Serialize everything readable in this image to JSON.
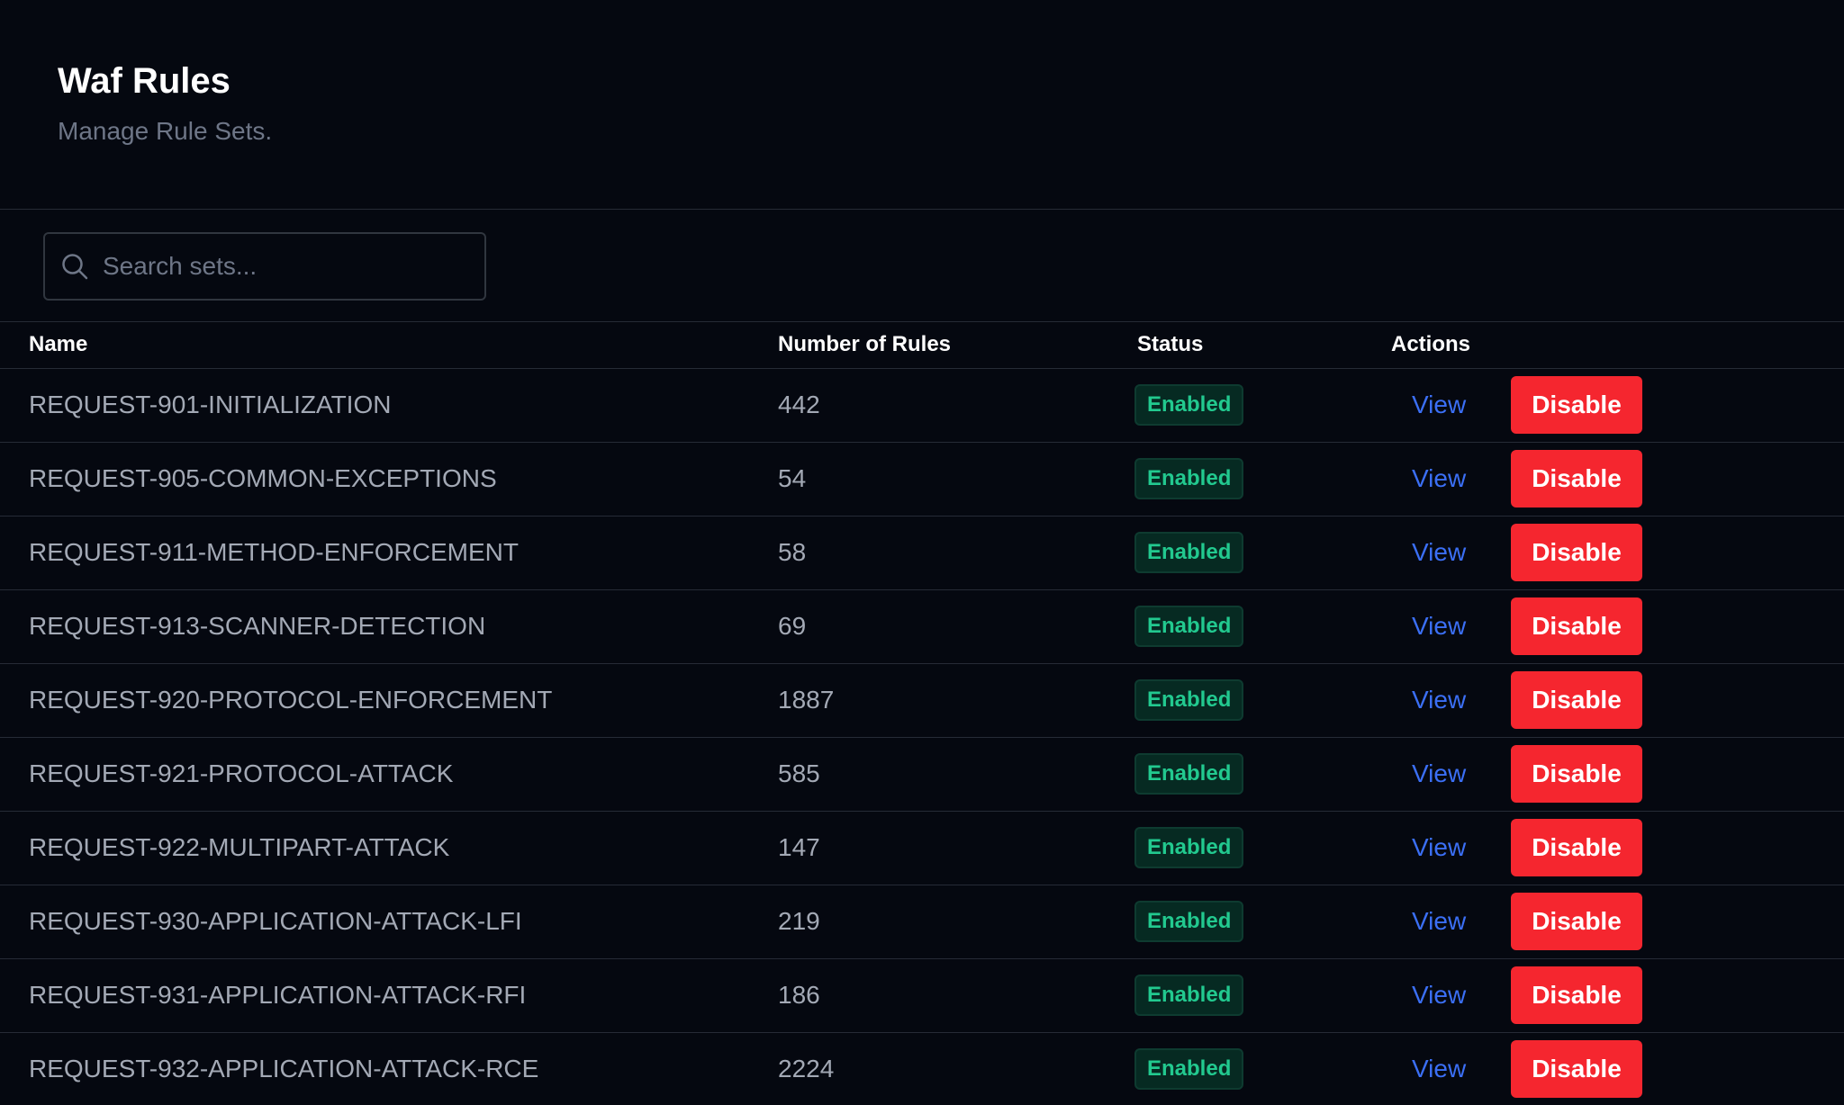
{
  "header": {
    "title": "Waf Rules",
    "subtitle": "Manage Rule Sets."
  },
  "search": {
    "placeholder": "Search sets...",
    "value": "",
    "icon": "search-icon"
  },
  "table": {
    "columns": {
      "name": "Name",
      "num_rules": "Number of Rules",
      "status": "Status",
      "actions": "Actions"
    },
    "rows": [
      {
        "name": "REQUEST-901-INITIALIZATION",
        "num_rules": "442",
        "status": "Enabled",
        "view": "View",
        "action": "Disable"
      },
      {
        "name": "REQUEST-905-COMMON-EXCEPTIONS",
        "num_rules": "54",
        "status": "Enabled",
        "view": "View",
        "action": "Disable"
      },
      {
        "name": "REQUEST-911-METHOD-ENFORCEMENT",
        "num_rules": "58",
        "status": "Enabled",
        "view": "View",
        "action": "Disable"
      },
      {
        "name": "REQUEST-913-SCANNER-DETECTION",
        "num_rules": "69",
        "status": "Enabled",
        "view": "View",
        "action": "Disable"
      },
      {
        "name": "REQUEST-920-PROTOCOL-ENFORCEMENT",
        "num_rules": "1887",
        "status": "Enabled",
        "view": "View",
        "action": "Disable"
      },
      {
        "name": "REQUEST-921-PROTOCOL-ATTACK",
        "num_rules": "585",
        "status": "Enabled",
        "view": "View",
        "action": "Disable"
      },
      {
        "name": "REQUEST-922-MULTIPART-ATTACK",
        "num_rules": "147",
        "status": "Enabled",
        "view": "View",
        "action": "Disable"
      },
      {
        "name": "REQUEST-930-APPLICATION-ATTACK-LFI",
        "num_rules": "219",
        "status": "Enabled",
        "view": "View",
        "action": "Disable"
      },
      {
        "name": "REQUEST-931-APPLICATION-ATTACK-RFI",
        "num_rules": "186",
        "status": "Enabled",
        "view": "View",
        "action": "Disable"
      },
      {
        "name": "REQUEST-932-APPLICATION-ATTACK-RCE",
        "num_rules": "2224",
        "status": "Enabled",
        "view": "View",
        "action": "Disable"
      }
    ]
  },
  "colors": {
    "background": "#050810",
    "enabled_text": "#22c98f",
    "enabled_bg": "#062a22",
    "link": "#3b6ff5",
    "danger": "#f5262f"
  }
}
